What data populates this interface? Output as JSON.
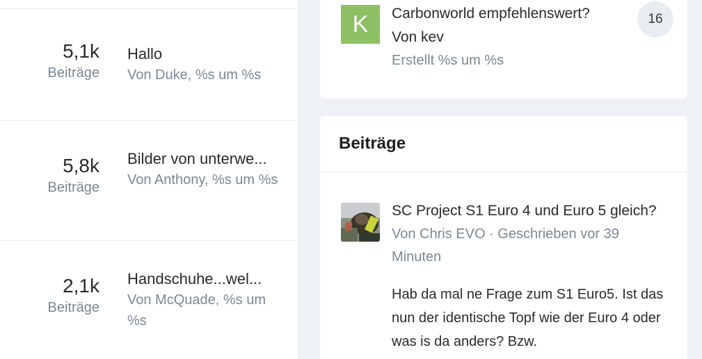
{
  "threads": [
    {
      "count": "5,1k",
      "count_label": "Beiträge",
      "title": "Hallo",
      "meta": "Von Duke, %s um %s"
    },
    {
      "count": "5,8k",
      "count_label": "Beiträge",
      "title": "Bilder von unterwe...",
      "meta": "Von Anthony, %s um %s"
    },
    {
      "count": "2,1k",
      "count_label": "Beiträge",
      "title": "Handschuhe...wel...",
      "meta": "Von McQuade, %s um %s"
    }
  ],
  "top_card": {
    "avatar_letter": "K",
    "title": "Carbonworld empfehlenswert?",
    "by": "Von kev",
    "created": "Erstellt %s um %s",
    "reply_count": "16"
  },
  "posts_card": {
    "heading": "Beiträge",
    "post": {
      "title": "SC Project S1 Euro 4 und Euro 5 gleich?",
      "meta": "Von Chris EVO · Geschrieben vor 39 Minuten",
      "body": "Hab da mal ne Frage zum S1 Euro5. Ist das nun der identische Topf wie der Euro 4 oder was is da anders? Bzw."
    }
  },
  "colors": {
    "avatar_k": "#8cc063",
    "muted_text": "#7a8794",
    "page_bg": "#eef1f5"
  }
}
